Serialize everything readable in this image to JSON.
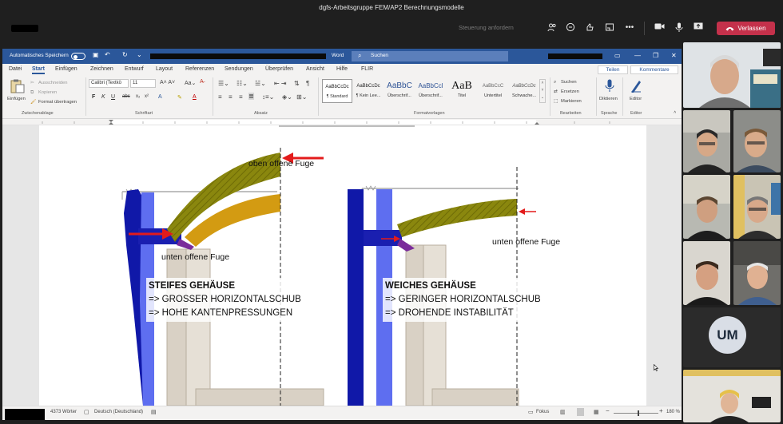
{
  "teams": {
    "meeting_title": "dgfs-Arbeitsgruppe FEM/AP2 Berechnungsmodelle",
    "request_control": "Steuerung anfordern",
    "leave_label": "Verlassen",
    "icons": [
      "people-icon",
      "chat-icon",
      "reactions-icon",
      "rooms-icon",
      "more-icon",
      "camera-icon",
      "mic-icon",
      "share-icon",
      "phone-icon"
    ]
  },
  "word": {
    "autosave_label": "Automatisches Speichern",
    "app_name": "Word",
    "search_placeholder": "Suchen",
    "tabs": [
      "Datei",
      "Start",
      "Einfügen",
      "Zeichnen",
      "Entwurf",
      "Layout",
      "Referenzen",
      "Sendungen",
      "Überprüfen",
      "Ansicht",
      "Hilfe",
      "FLIR"
    ],
    "share_label": "Teilen",
    "comments_label": "Kommentare",
    "clipboard": {
      "paste": "Einfügen",
      "cut": "Ausschneiden",
      "copy": "Kopieren",
      "format_painter": "Format übertragen",
      "group": "Zwischenablage"
    },
    "font": {
      "name": "Calibri (Textkö",
      "size": "11",
      "bold": "F",
      "italic": "K",
      "underline": "U",
      "strike": "abc",
      "group": "Schriftart"
    },
    "paragraph_group": "Absatz",
    "styles": [
      {
        "sample": "AaBbCcDc",
        "name": "¶ Standard"
      },
      {
        "sample": "AaBbCcDc",
        "name": "¶ Kein Lee..."
      },
      {
        "sample": "AaBbC",
        "name": "Überschrif..."
      },
      {
        "sample": "AaBbCcl",
        "name": "Überschrif..."
      },
      {
        "sample": "AaB",
        "name": "Titel"
      },
      {
        "sample": "AaBbCcC",
        "name": "Untertitel"
      },
      {
        "sample": "AaBbCcDc",
        "name": "Schwache..."
      }
    ],
    "styles_group": "Formatvorlagen",
    "editing": {
      "search": "Suchen",
      "replace": "Ersetzen",
      "select": "Markieren",
      "group": "Bearbeiten"
    },
    "voice": {
      "dictate": "Diktieren",
      "group": "Sprache"
    },
    "editor": {
      "label": "Editor",
      "group": "Editor"
    },
    "status": {
      "words": "4373 Wörter",
      "language": "Deutsch (Deutschland)",
      "focus": "Fokus",
      "zoom": "180 %"
    }
  },
  "figure": {
    "top_caption": "oben offene Fuge",
    "left_bottom_caption": "unten offene Fuge",
    "right_bottom_caption": "unten offene Fuge",
    "left_panel": {
      "heading": "STEIFES GEHÄUSE",
      "line1": "=> GROSSER HORIZONTALSCHUB",
      "line2": "=> HOHE KANTENPRESSUNGEN"
    },
    "right_panel": {
      "heading": "WEICHES GEHÄUSE",
      "line1": "=> GERINGER HORIZONTALSCHUB",
      "line2": "=> DROHENDE INSTABILITÄT"
    },
    "colors": {
      "blue_dark": "#1018a8",
      "blue_light": "#5e6ef0",
      "olive": "#7d7a0a",
      "orange": "#d39b12",
      "purple": "#7a2b9a",
      "red": "#e31b1b",
      "concrete": "#d7cfc2"
    }
  },
  "participants": {
    "initials": "UM"
  }
}
